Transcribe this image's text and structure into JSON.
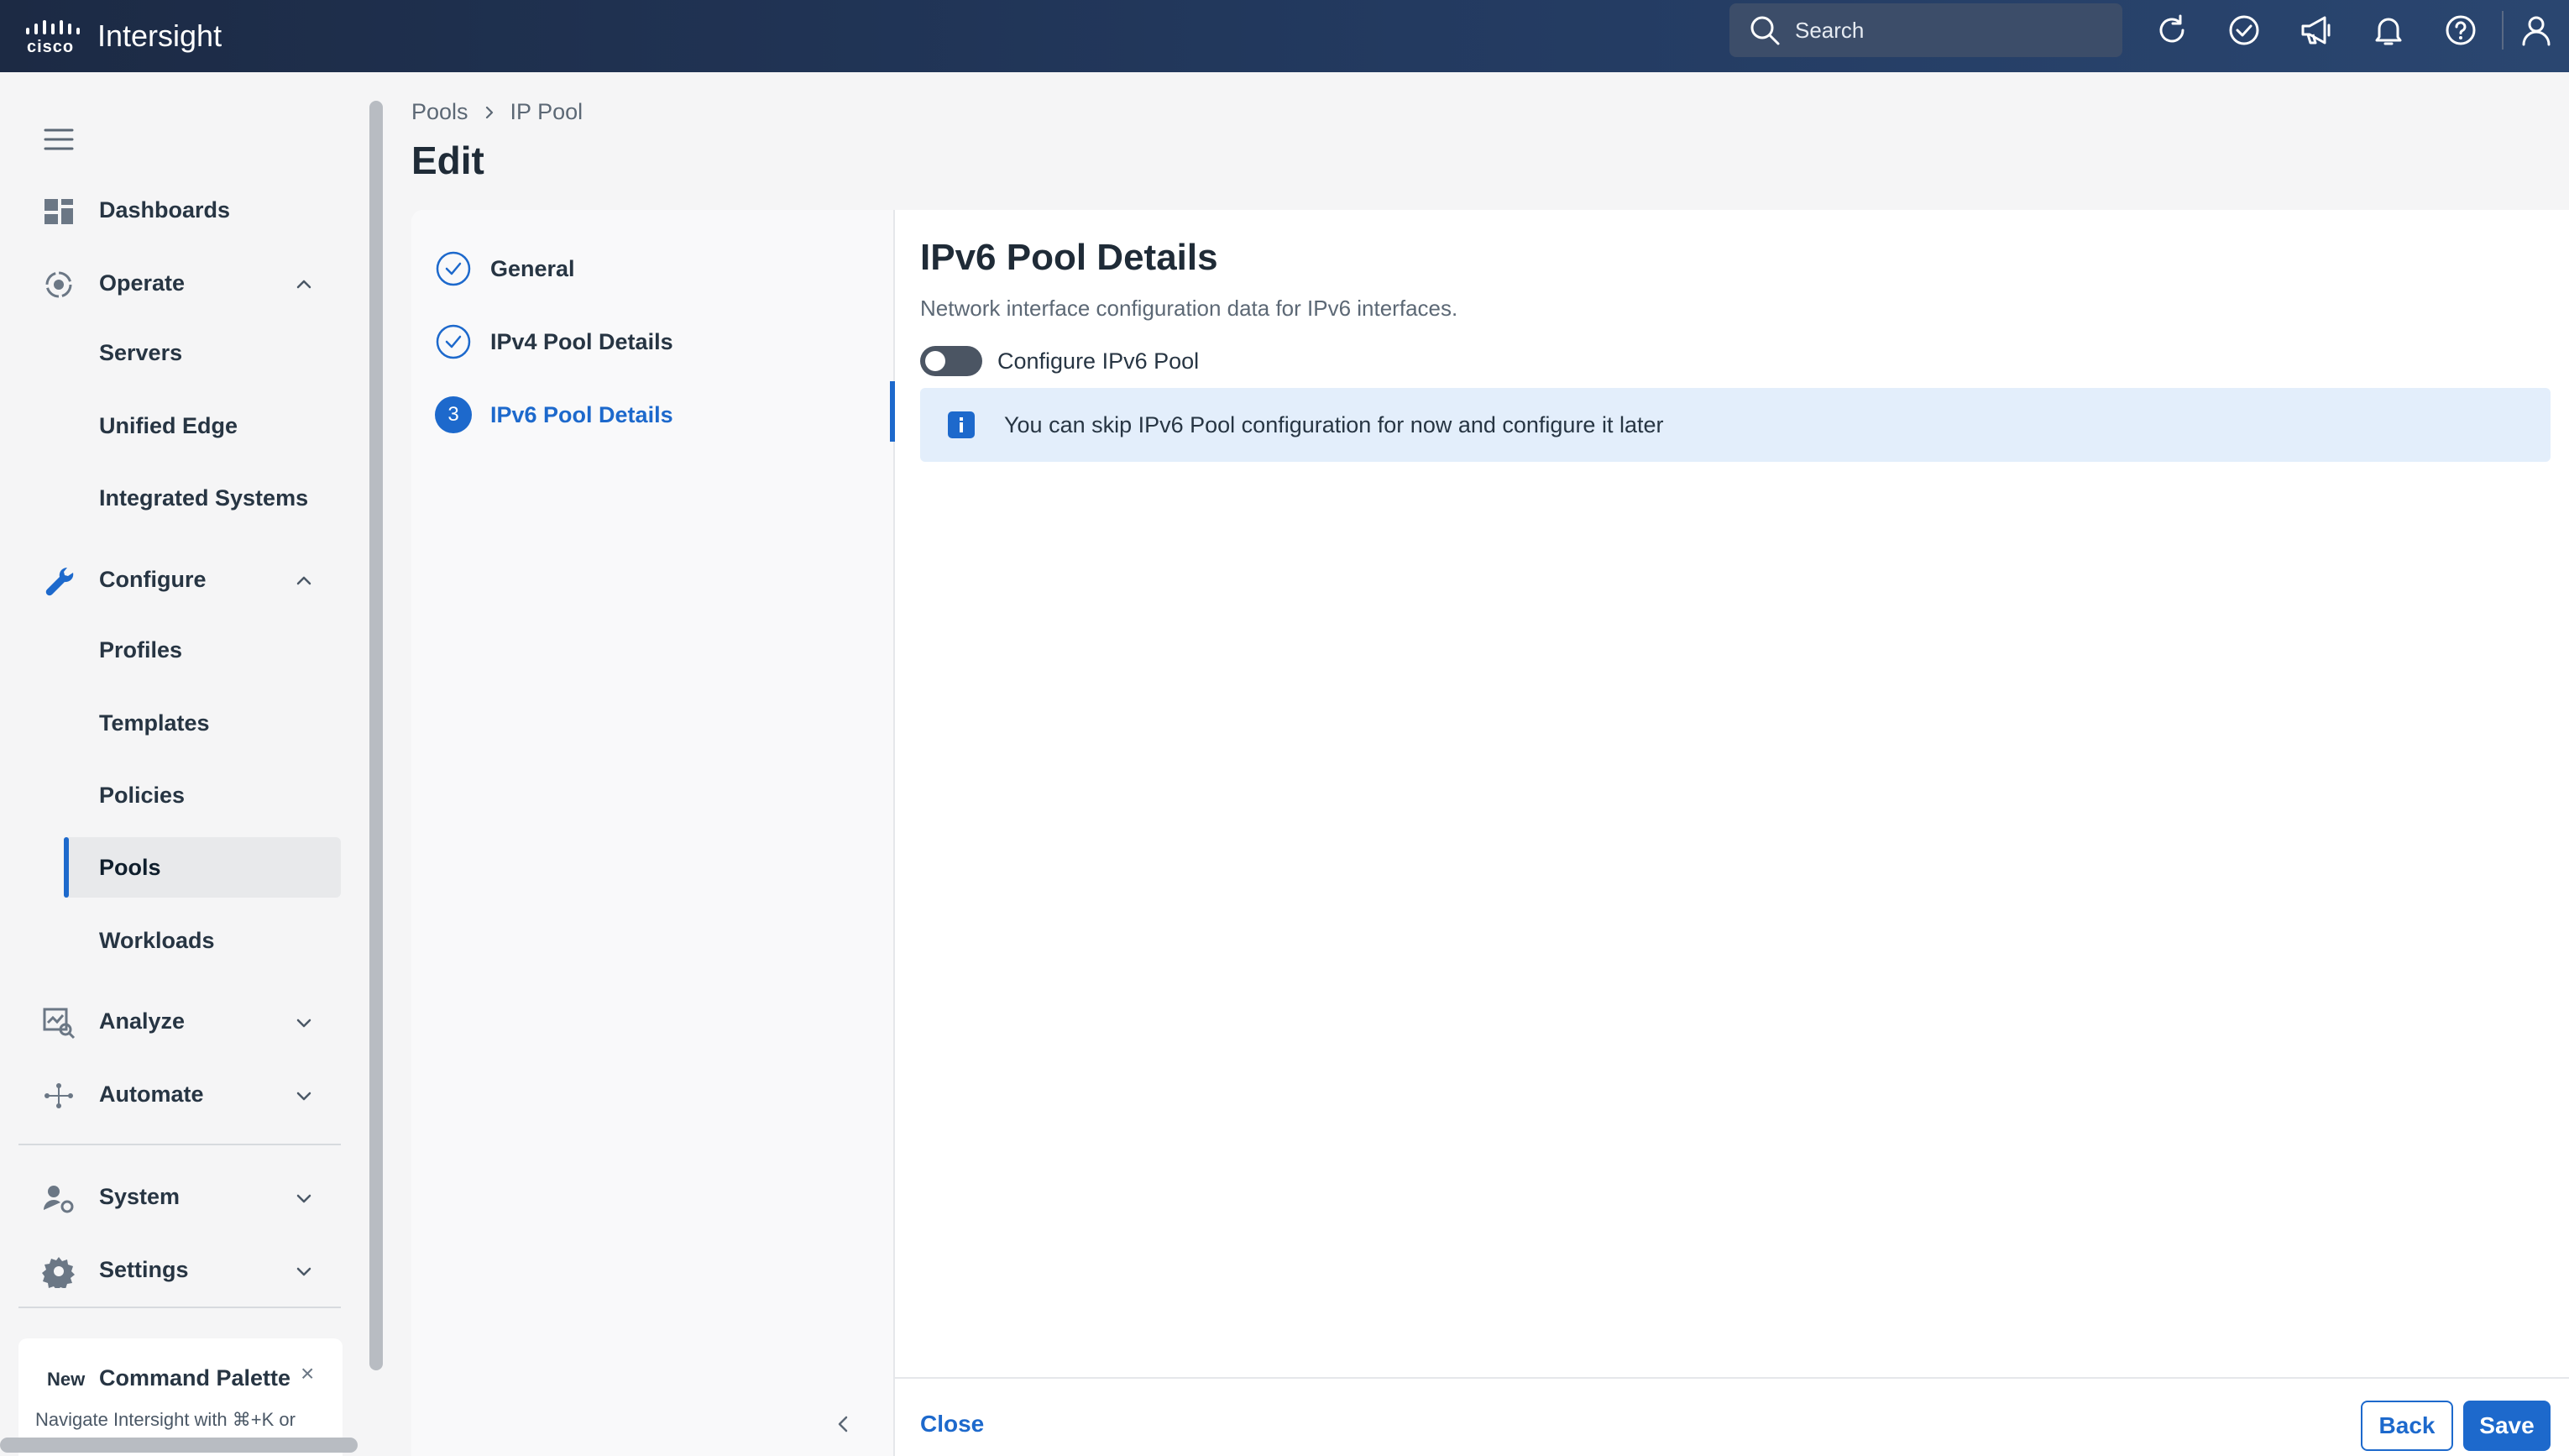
{
  "app": {
    "brand_word": "cisco",
    "title": "Intersight"
  },
  "search": {
    "placeholder": "Search"
  },
  "top_icons": [
    "refresh-icon",
    "check-circle-icon",
    "megaphone-icon",
    "bell-icon",
    "help-icon",
    "user-icon"
  ],
  "sidebar": {
    "items": [
      {
        "label": "Dashboards",
        "icon": "dashboard-icon"
      },
      {
        "label": "Operate",
        "icon": "operate-icon",
        "expanded": true,
        "children": [
          "Servers",
          "Unified Edge",
          "Integrated Systems"
        ]
      },
      {
        "label": "Configure",
        "icon": "wrench-icon",
        "expanded": true,
        "children": [
          "Profiles",
          "Templates",
          "Policies",
          "Pools",
          "Workloads"
        ]
      },
      {
        "label": "Analyze",
        "icon": "analyze-icon",
        "expanded": false
      },
      {
        "label": "Automate",
        "icon": "automate-icon",
        "expanded": false
      },
      {
        "label": "System",
        "icon": "system-icon",
        "expanded": false
      },
      {
        "label": "Settings",
        "icon": "gear-icon",
        "expanded": false
      }
    ],
    "active_child": "Pools"
  },
  "command_palette": {
    "badge": "New",
    "title": "Command Palette",
    "desc": "Navigate Intersight with ⌘+K or"
  },
  "breadcrumb": [
    "Pools",
    "IP Pool"
  ],
  "page_title": "Edit",
  "wizard": {
    "steps": [
      {
        "label": "General",
        "state": "complete"
      },
      {
        "label": "IPv4 Pool Details",
        "state": "complete"
      },
      {
        "label": "IPv6 Pool Details",
        "state": "current",
        "number": "3"
      }
    ],
    "section_title": "IPv6 Pool Details",
    "section_desc": "Network interface configuration data for IPv6 interfaces.",
    "toggle_label": "Configure IPv6 Pool",
    "toggle_on": false,
    "info_message": "You can skip IPv6 Pool configuration for now and configure it later",
    "footer": {
      "close": "Close",
      "back": "Back",
      "save": "Save"
    }
  },
  "colors": {
    "accent": "#1d69cc",
    "topbar": "#1c2a44",
    "info_bg": "#e3eefb"
  }
}
